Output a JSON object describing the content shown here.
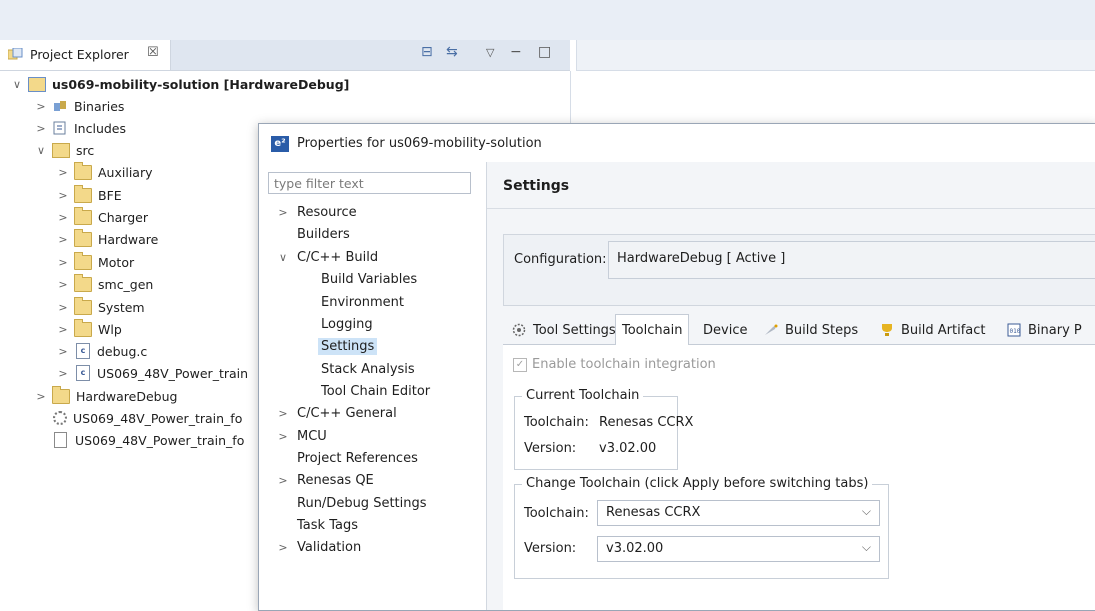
{
  "project_explorer": {
    "tab_title": "Project Explorer",
    "close_glyph": "☒",
    "toolbar_icons": [
      "collapse-all-icon",
      "link-with-editor-icon",
      "view-menu-icon",
      "minimize-icon",
      "maximize-icon"
    ],
    "tree": [
      {
        "label": "us069-mobility-solution [HardwareDebug]",
        "twisty": "∨",
        "icon": "project-icon",
        "bold": true
      },
      {
        "label": "Binaries",
        "twisty": ">",
        "icon": "binaries-icon"
      },
      {
        "label": "Includes",
        "twisty": ">",
        "icon": "includes-icon"
      },
      {
        "label": "src",
        "twisty": "∨",
        "icon": "source-folder-icon"
      },
      {
        "label": "Auxiliary",
        "twisty": ">",
        "icon": "folder-icon"
      },
      {
        "label": "BFE",
        "twisty": ">",
        "icon": "folder-icon"
      },
      {
        "label": "Charger",
        "twisty": ">",
        "icon": "folder-icon"
      },
      {
        "label": "Hardware",
        "twisty": ">",
        "icon": "folder-icon"
      },
      {
        "label": "Motor",
        "twisty": ">",
        "icon": "folder-icon"
      },
      {
        "label": "smc_gen",
        "twisty": ">",
        "icon": "folder-icon"
      },
      {
        "label": "System",
        "twisty": ">",
        "icon": "folder-icon"
      },
      {
        "label": "Wlp",
        "twisty": ">",
        "icon": "folder-icon"
      },
      {
        "label": "debug.c",
        "twisty": ">",
        "icon": "c-file-icon"
      },
      {
        "label": "US069_48V_Power_train",
        "twisty": ">",
        "icon": "c-file-icon"
      },
      {
        "label": "HardwareDebug",
        "twisty": ">",
        "icon": "folder-icon"
      },
      {
        "label": "US069_48V_Power_train_fo",
        "twisty": "",
        "icon": "gear-file-icon"
      },
      {
        "label": "US069_48V_Power_train_fo",
        "twisty": "",
        "icon": "document-icon"
      }
    ]
  },
  "dialog": {
    "title": "Properties for us069-mobility-solution",
    "filter_placeholder": "type filter text",
    "nav": [
      {
        "label": "Resource",
        "twisty": ">"
      },
      {
        "label": "Builders",
        "twisty": ""
      },
      {
        "label": "C/C++ Build",
        "twisty": "∨"
      },
      {
        "label": "Build Variables",
        "twisty": ""
      },
      {
        "label": "Environment",
        "twisty": ""
      },
      {
        "label": "Logging",
        "twisty": ""
      },
      {
        "label": "Settings",
        "twisty": "",
        "selected": true
      },
      {
        "label": "Stack Analysis",
        "twisty": ""
      },
      {
        "label": "Tool Chain Editor",
        "twisty": ""
      },
      {
        "label": "C/C++ General",
        "twisty": ">"
      },
      {
        "label": "MCU",
        "twisty": ">"
      },
      {
        "label": "Project References",
        "twisty": ""
      },
      {
        "label": "Renesas QE",
        "twisty": ">"
      },
      {
        "label": "Run/Debug Settings",
        "twisty": ""
      },
      {
        "label": "Task Tags",
        "twisty": ""
      },
      {
        "label": "Validation",
        "twisty": ">"
      }
    ],
    "settings_title": "Settings",
    "configuration_label": "Configuration:",
    "configuration_value": "HardwareDebug  [ Active ]",
    "tabs": [
      {
        "label": "Tool Settings",
        "icon": "tool-settings-icon"
      },
      {
        "label": "Toolchain",
        "icon": "",
        "active": true
      },
      {
        "label": "Device",
        "icon": ""
      },
      {
        "label": "Build Steps",
        "icon": "build-steps-icon"
      },
      {
        "label": "Build Artifact",
        "icon": "build-artifact-icon"
      },
      {
        "label": "Binary P",
        "icon": "binary-parsers-icon"
      }
    ],
    "enable_integration": "Enable toolchain integration",
    "current_toolchain": {
      "title": "Current Toolchain",
      "toolchain_label": "Toolchain:",
      "toolchain_value": "Renesas CCRX",
      "version_label": "Version:",
      "version_value": "v3.02.00"
    },
    "change_toolchain": {
      "title": "Change Toolchain (click Apply before switching tabs)",
      "toolchain_label": "Toolchain:",
      "toolchain_value": "Renesas CCRX",
      "version_label": "Version:",
      "version_value": "v3.02.00"
    }
  }
}
